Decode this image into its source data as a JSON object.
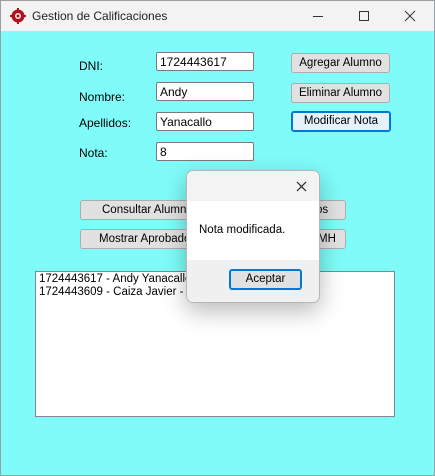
{
  "window": {
    "title": "Gestion de Calificaciones",
    "background": "#7ffcf9",
    "icon": "app-gear-icon"
  },
  "form": {
    "dni_label": "DNI:",
    "dni_value": "1724443617",
    "nombre_label": "Nombre:",
    "nombre_value": "Andy",
    "apellidos_label": "Apellidos:",
    "apellidos_value": "Yanacallo",
    "nota_label": "Nota:",
    "nota_value": "8"
  },
  "buttons": {
    "agregar": "Agregar Alumno",
    "eliminar": "Eliminar Alumno",
    "modificar": "Modificar Nota",
    "consultar": "Consultar Alumno",
    "mostrar_aprobados": "Mostrar Aprobados",
    "hidden_right_top_visible": "os",
    "hidden_right_bottom_visible": "MH"
  },
  "list": {
    "items": [
      "1724443617 - Andy Yanacallo -",
      "1724443609 - Caiza Javier - No"
    ]
  },
  "dialog": {
    "message": "Nota modificada.",
    "ok_label": "Aceptar",
    "accent": "#0078d7"
  }
}
